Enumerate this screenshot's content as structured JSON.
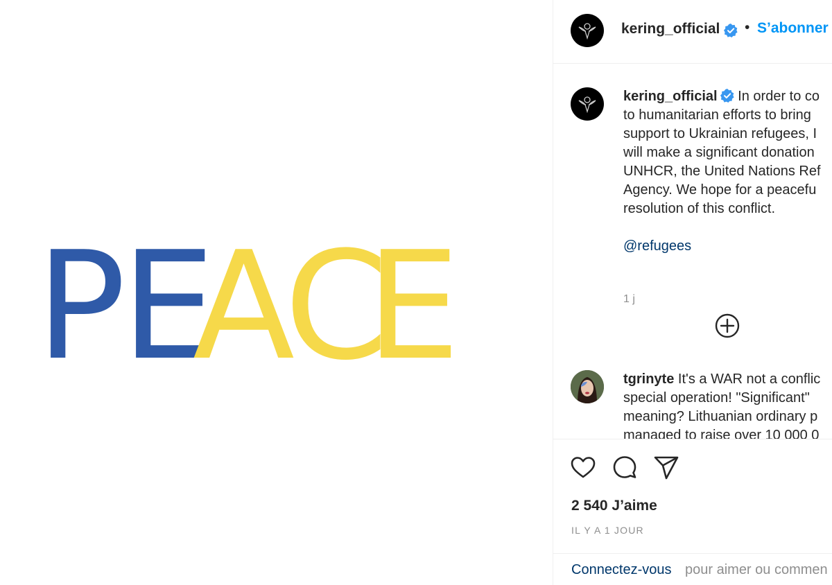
{
  "media": {
    "letters": [
      "P",
      "E",
      "A",
      "C",
      "E"
    ],
    "colors": {
      "blue": "#2f5aa8",
      "yellow": "#f6d94a"
    }
  },
  "post": {
    "author": "kering_official",
    "follow_label": "S’abonner",
    "separator": "•",
    "caption_lines": [
      "In order to co",
      "to humanitarian efforts to bring",
      "support to Ukrainian refugees, I",
      "will make a significant donation",
      "UNHCR, the United Nations Ref",
      "Agency. We hope for a peacefu",
      "resolution of this conflict."
    ],
    "mention": "@refugees",
    "time": "1 j"
  },
  "comments": [
    {
      "user": "tgrinyte",
      "lines": [
        "It's a WAR not a conflic",
        "special operation! \"Significant\"",
        "meaning? Lithuanian ordinary p",
        "managed to raise over 10 000 0"
      ]
    }
  ],
  "actions": {
    "likes": "2 540 J’aime",
    "ago": "IL Y A 1 JOUR"
  },
  "login": {
    "link": "Connectez-vous",
    "rest": "pour aimer ou commen"
  },
  "icons": {
    "avatar": "kering-logo-icon",
    "verified": "verified-badge-icon",
    "load_more": "plus-circle-icon",
    "like": "heart-icon",
    "comment": "comment-icon",
    "share": "share-icon"
  },
  "colors": {
    "link_blue": "#0095f6",
    "verified": "#3897f0",
    "mention": "#00376b",
    "muted": "#8e8e8e"
  }
}
